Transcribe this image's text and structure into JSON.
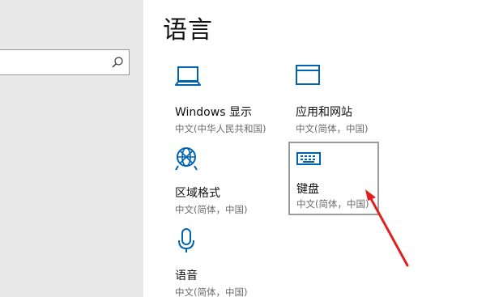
{
  "page": {
    "title": "语言"
  },
  "search": {
    "placeholder": ""
  },
  "tiles": [
    {
      "icon": "laptop-icon",
      "title": "Windows 显示",
      "subtitle": "中文(中华人民共和国)"
    },
    {
      "icon": "window-icon",
      "title": "应用和网站",
      "subtitle": "中文(简体，中国)"
    },
    {
      "icon": "globe-keyboard-icon",
      "title": "区域格式",
      "subtitle": "中文(简体，中国)"
    },
    {
      "icon": "keyboard-icon",
      "title": "键盘",
      "subtitle": "中文(简体，中国)"
    },
    {
      "icon": "microphone-icon",
      "title": "语音",
      "subtitle": "中文(简体，中国)"
    }
  ],
  "colors": {
    "accent": "#0063b1",
    "annotation_arrow": "#e02020",
    "selected_border": "#9b9b9b"
  }
}
